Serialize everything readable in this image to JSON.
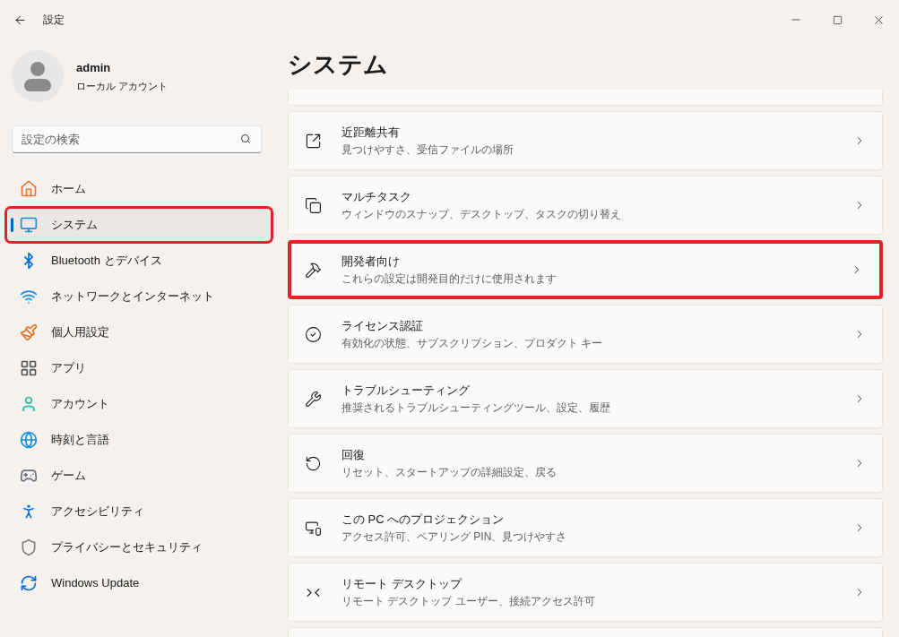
{
  "window": {
    "title": "設定"
  },
  "account": {
    "name": "admin",
    "type": "ローカル アカウント"
  },
  "search": {
    "placeholder": "設定の検索"
  },
  "sidebar": {
    "items": [
      {
        "label": "ホーム",
        "selected": false,
        "highlighted": false
      },
      {
        "label": "システム",
        "selected": true,
        "highlighted": true
      },
      {
        "label": "Bluetooth とデバイス",
        "selected": false,
        "highlighted": false
      },
      {
        "label": "ネットワークとインターネット",
        "selected": false,
        "highlighted": false
      },
      {
        "label": "個人用設定",
        "selected": false,
        "highlighted": false
      },
      {
        "label": "アプリ",
        "selected": false,
        "highlighted": false
      },
      {
        "label": "アカウント",
        "selected": false,
        "highlighted": false
      },
      {
        "label": "時刻と言語",
        "selected": false,
        "highlighted": false
      },
      {
        "label": "ゲーム",
        "selected": false,
        "highlighted": false
      },
      {
        "label": "アクセシビリティ",
        "selected": false,
        "highlighted": false
      },
      {
        "label": "プライバシーとセキュリティ",
        "selected": false,
        "highlighted": false
      },
      {
        "label": "Windows Update",
        "selected": false,
        "highlighted": false
      }
    ]
  },
  "page": {
    "title": "システム"
  },
  "settings": [
    {
      "title": "近距離共有",
      "description": "見つけやすさ、受信ファイルの場所",
      "highlighted": false
    },
    {
      "title": "マルチタスク",
      "description": "ウィンドウのスナップ、デスクトップ、タスクの切り替え",
      "highlighted": false
    },
    {
      "title": "開発者向け",
      "description": "これらの設定は開発目的だけに使用されます",
      "highlighted": true
    },
    {
      "title": "ライセンス認証",
      "description": "有効化の状態、サブスクリプション、プロダクト キー",
      "highlighted": false
    },
    {
      "title": "トラブルシューティング",
      "description": "推奨されるトラブルシューティングツール、設定、履歴",
      "highlighted": false
    },
    {
      "title": "回復",
      "description": "リセット、スタートアップの詳細設定、戻る",
      "highlighted": false
    },
    {
      "title": "この PC へのプロジェクション",
      "description": "アクセス許可、ペアリング PIN、見つけやすさ",
      "highlighted": false
    },
    {
      "title": "リモート デスクトップ",
      "description": "リモート デスクトップ ユーザー、接続アクセス許可",
      "highlighted": false
    }
  ]
}
